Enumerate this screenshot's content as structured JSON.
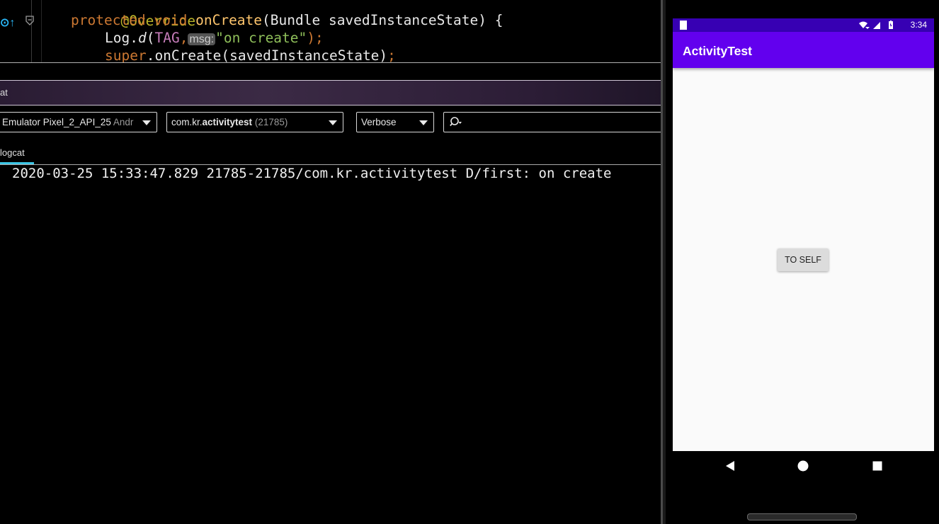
{
  "editor": {
    "lines": {
      "l0_annotation": "@Override",
      "l1_kw": "protected void ",
      "l1_fn": "onCreate",
      "l1_rest": "(Bundle savedInstanceState) {",
      "l2_obj": "Log.",
      "l2_method": "d",
      "l2_paren": "(",
      "l2_const": "TAG",
      "l2_comma": ",",
      "l2_hint": "msg:",
      "l2_str": "\"on create\"",
      "l2_end": ");",
      "l3_kw": "super",
      "l3_rest": ".onCreate(savedInstanceState)",
      "l3_end": ";"
    }
  },
  "logcat_panel": {
    "title": "at",
    "device": {
      "name": "Emulator Pixel_2_API_25",
      "suffix": "Andrc"
    },
    "process": {
      "prefix": "com.kr.",
      "name": "activitytest",
      "pid": "(21785)"
    },
    "level": "Verbose",
    "search": {
      "value": ""
    },
    "tab": "logcat",
    "log_lines": [
      "2020-03-25 15:33:47.829 21785-21785/com.kr.activitytest D/first: on create"
    ]
  },
  "emulator": {
    "clock": "3:34",
    "app_title": "ActivityTest",
    "button_label": "TO SELF",
    "colors": {
      "status_bar": "#3700b3",
      "app_bar": "#6200ee",
      "background": "#fafafa"
    }
  }
}
